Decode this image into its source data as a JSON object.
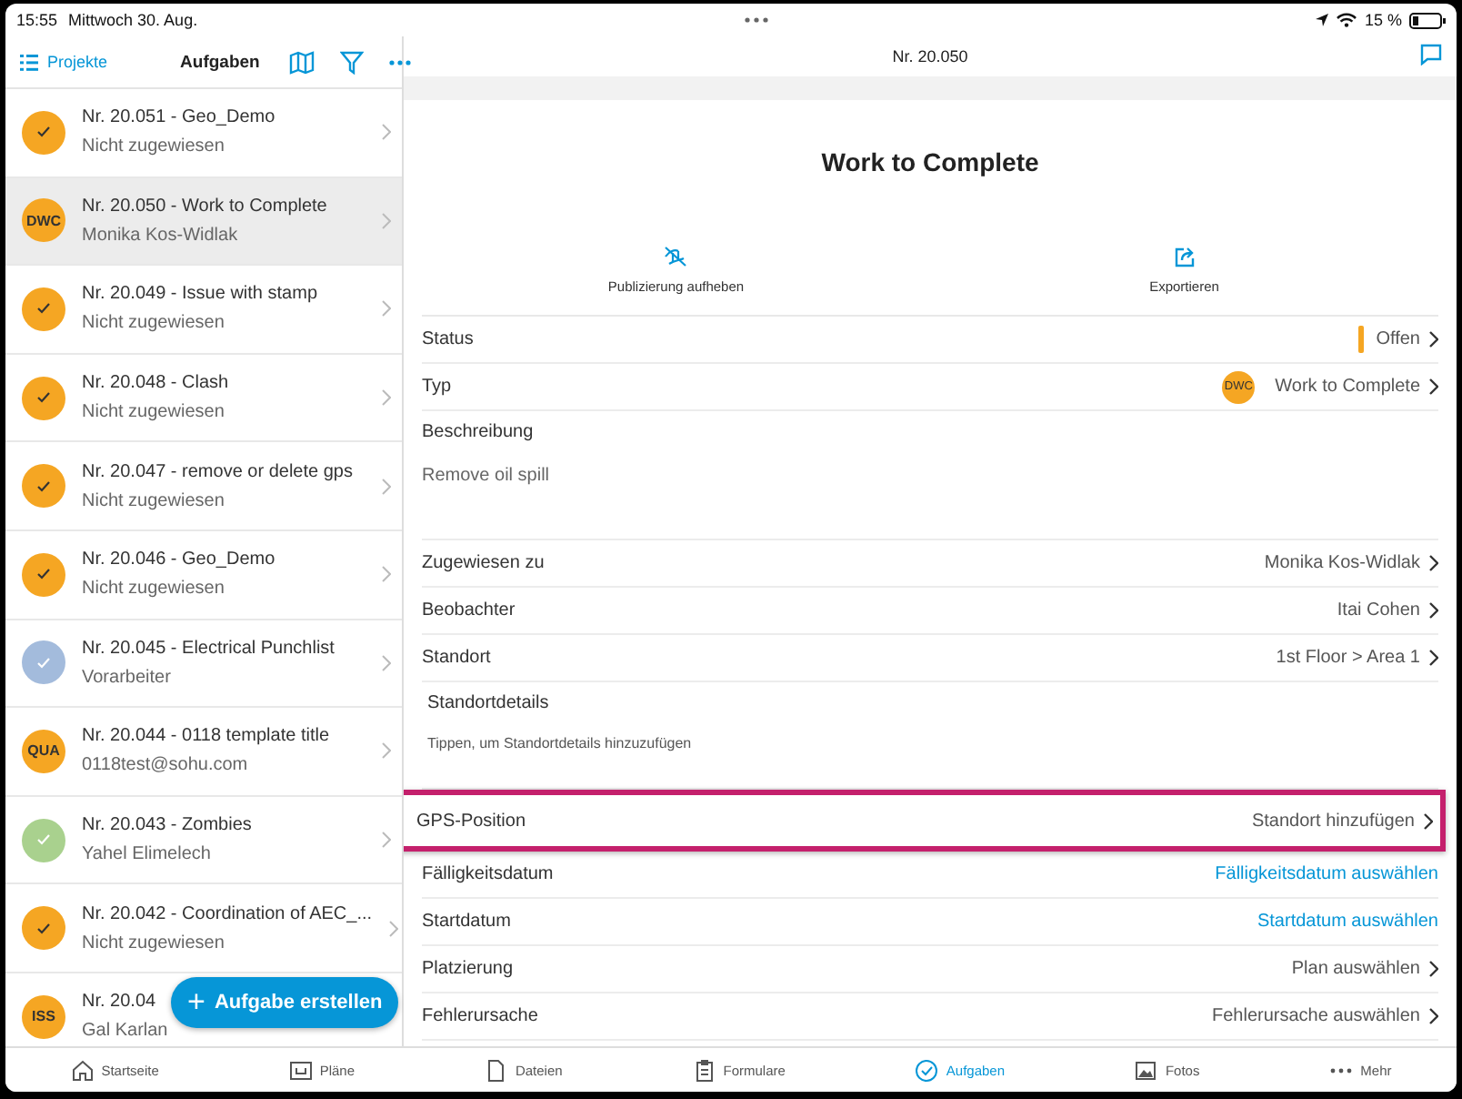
{
  "status_bar": {
    "time": "15:55",
    "date": "Mittwoch 30. Aug.",
    "battery_text": "15 %"
  },
  "sidebar": {
    "back_link": "Projekte",
    "title": "Aufgaben",
    "items": [
      {
        "title": "Nr. 20.051  -  Geo_Demo",
        "subtitle": "Nicht zugewiesen",
        "kind": "check",
        "color": "#f5a623",
        "selected": false
      },
      {
        "title": "Nr. 20.050  -  Work to Complete",
        "subtitle": "Monika Kos-Widlak",
        "kind": "initials",
        "initials": "DWC",
        "color": "#f5a623",
        "selected": true
      },
      {
        "title": "Nr. 20.049  -  Issue with stamp",
        "subtitle": "Nicht zugewiesen",
        "kind": "check",
        "color": "#f5a623",
        "selected": false
      },
      {
        "title": "Nr. 20.048  -  Clash",
        "subtitle": "Nicht zugewiesen",
        "kind": "check",
        "color": "#f5a623",
        "selected": false
      },
      {
        "title": "Nr. 20.047  -  remove or delete gps",
        "subtitle": "Nicht zugewiesen",
        "kind": "check",
        "color": "#f5a623",
        "selected": false
      },
      {
        "title": "Nr. 20.046  -  Geo_Demo",
        "subtitle": "Nicht zugewiesen",
        "kind": "check",
        "color": "#f5a623",
        "selected": false
      },
      {
        "title": "Nr. 20.045  -  Electrical Punchlist",
        "subtitle": "Vorarbeiter",
        "kind": "check",
        "color": "#a3bbdc",
        "selected": false
      },
      {
        "title": "Nr. 20.044  -  0118 template title",
        "subtitle": "0118test@sohu.com",
        "kind": "initials",
        "initials": "QUA",
        "color": "#f5a623",
        "selected": false
      },
      {
        "title": "Nr. 20.043  -  Zombies",
        "subtitle": "Yahel Elimelech",
        "kind": "check",
        "color": "#a9d18e",
        "selected": false
      },
      {
        "title": "Nr. 20.042  -  Coordination of AEC_...",
        "subtitle": "Nicht zugewiesen",
        "kind": "check",
        "color": "#f5a623",
        "selected": false
      },
      {
        "title": "Nr. 20.04",
        "subtitle": "Gal Karlan",
        "kind": "initials",
        "initials": "ISS",
        "color": "#f5a623",
        "selected": false
      }
    ],
    "create_button": "Aufgabe erstellen",
    "create_icon": "+"
  },
  "detail": {
    "header_title": "Nr. 20.050",
    "title": "Work to Complete",
    "actions": [
      {
        "label": "Publizierung aufheben"
      },
      {
        "label": "Exportieren"
      }
    ],
    "fields": [
      {
        "kind": "status",
        "label": "Status",
        "value": "Offen",
        "color": "#f5a623"
      },
      {
        "kind": "type",
        "label": "Typ",
        "value": "Work to Complete",
        "badge": "DWC"
      },
      {
        "kind": "text",
        "label": "Beschreibung",
        "value": "Remove oil spill"
      },
      {
        "kind": "link",
        "label": "Zugewiesen zu",
        "value": "Monika Kos-Widlak"
      },
      {
        "kind": "link",
        "label": "Beobachter",
        "value": "Itai Cohen"
      },
      {
        "kind": "link",
        "label": "Standort",
        "value": "1st Floor > Area 1"
      },
      {
        "kind": "hint",
        "label": "Standortdetails",
        "value": "Tippen, um Standortdetails hinzuzufügen"
      },
      {
        "kind": "link",
        "label": "GPS-Position",
        "value": "Standort hinzufügen",
        "highlighted": true
      },
      {
        "kind": "action",
        "label": "Fälligkeitsdatum",
        "value": "Fälligkeitsdatum auswählen"
      },
      {
        "kind": "action",
        "label": "Startdatum",
        "value": "Startdatum auswählen"
      },
      {
        "kind": "link",
        "label": "Platzierung",
        "value": "Plan auswählen"
      },
      {
        "kind": "link",
        "label": "Fehlerursache",
        "value": "Fehlerursache auswählen"
      }
    ]
  },
  "tab_bar": [
    {
      "label": "Startseite",
      "selected": false
    },
    {
      "label": "Pläne",
      "selected": false
    },
    {
      "label": "Dateien",
      "selected": false
    },
    {
      "label": "Formulare",
      "selected": false
    },
    {
      "label": "Aufgaben",
      "selected": true
    },
    {
      "label": "Fotos",
      "selected": false
    },
    {
      "label": "Mehr",
      "selected": false
    }
  ]
}
